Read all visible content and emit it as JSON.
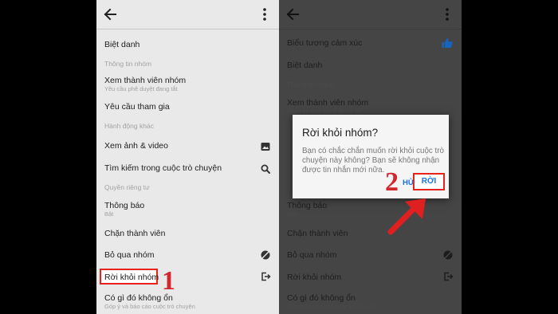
{
  "left": {
    "items": [
      {
        "label": "Biệt danh"
      },
      {
        "section": "Thông tin nhóm"
      },
      {
        "label": "Xem thành viên nhóm",
        "sub": "Yêu cầu phê duyệt đang tắt"
      },
      {
        "label": "Yêu cầu tham gia"
      },
      {
        "section": "Hành động khác"
      },
      {
        "label": "Xem ảnh & video",
        "icon": "image-icon"
      },
      {
        "label": "Tìm kiếm trong cuộc trò chuyện",
        "icon": "search-icon"
      },
      {
        "section": "Quyền riêng tư"
      },
      {
        "label": "Thông báo",
        "sub": "Bật"
      },
      {
        "label": "Chặn thành viên"
      },
      {
        "label": "Bỏ qua nhóm",
        "icon": "mute-icon"
      },
      {
        "label": "Rời khỏi nhóm",
        "icon": "logout-icon"
      },
      {
        "label": "Có gì đó không ổn",
        "sub": "Góp ý và báo cáo cuộc trò chuyện"
      }
    ]
  },
  "right": {
    "items": [
      {
        "label": "Biểu tượng cảm xúc",
        "icon": "thumbs-up-icon"
      },
      {
        "label": "Biệt danh"
      },
      {
        "section": "Thông tin nhóm"
      },
      {
        "label": "Xem thành viên nhóm",
        "sub": "Yêu cầu phê duyệt đang tắt"
      },
      {
        "label": "Thông báo",
        "sub": "Bật"
      },
      {
        "label": "Chặn thành viên"
      },
      {
        "label": "Bỏ qua nhóm",
        "icon": "mute-icon"
      },
      {
        "label": "Rời khỏi nhóm",
        "icon": "logout-icon"
      },
      {
        "label": "Có gì đó không ổn",
        "sub": "Góp ý và báo cáo cuộc trò chuyện"
      }
    ],
    "dialog": {
      "title": "Rời khỏi nhóm?",
      "body": "Bạn có chắc chắn muốn rời khỏi cuộc trò chuyện này không? Bạn sẽ không nhận được tin nhắn mới nữa.",
      "cancel_label": "HỦY",
      "confirm_label": "RỜI"
    }
  },
  "annotations": {
    "step1": "1",
    "step2": "2"
  },
  "colors": {
    "highlight": "#e8231f",
    "step_number": "#d2272d",
    "accent": "#1a73e8"
  }
}
